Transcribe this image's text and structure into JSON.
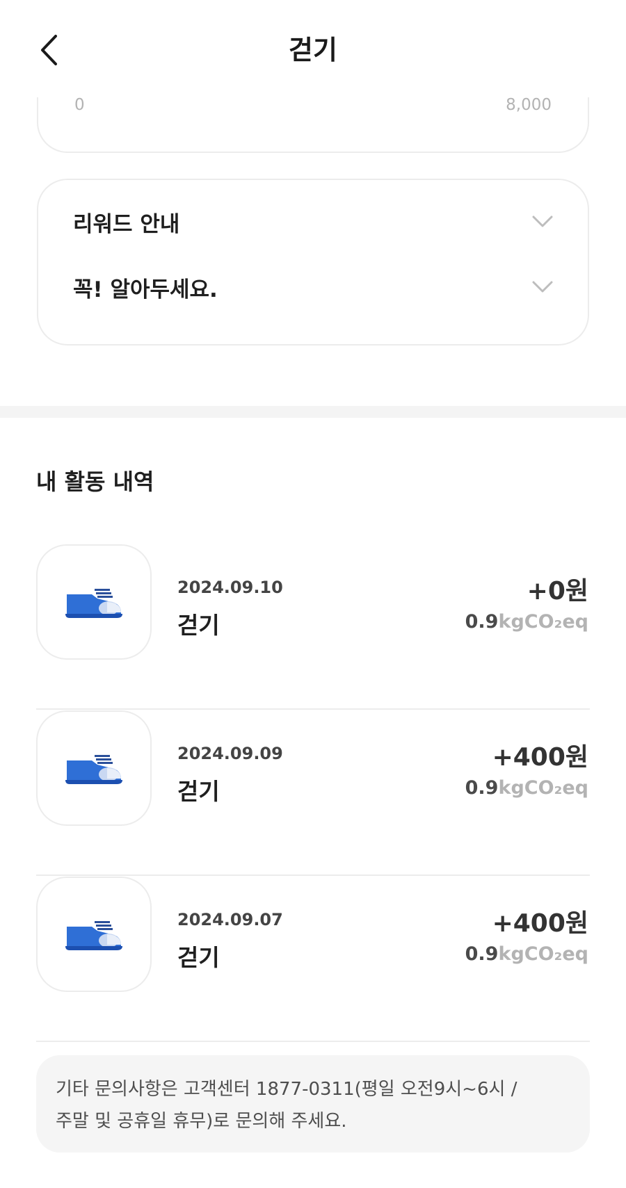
{
  "header": {
    "title": "걷기",
    "back_icon": "chevron-left-icon"
  },
  "range": {
    "min": "0",
    "max": "8,000"
  },
  "info": [
    {
      "label": "리워드 안내",
      "icon": "chevron-down-icon"
    },
    {
      "label": "꼭! 알아두세요.",
      "icon": "chevron-down-icon"
    }
  ],
  "section": {
    "title": "내 활동 내역"
  },
  "activities": [
    {
      "date": "2024.09.10",
      "name": "걷기",
      "amount": "+0원",
      "co2_value": "0.9",
      "co2_unit": "kgCO₂eq",
      "icon": "sneaker-icon"
    },
    {
      "date": "2024.09.09",
      "name": "걷기",
      "amount": "+400원",
      "co2_value": "0.9",
      "co2_unit": "kgCO₂eq",
      "icon": "sneaker-icon"
    },
    {
      "date": "2024.09.07",
      "name": "걷기",
      "amount": "+400원",
      "co2_value": "0.9",
      "co2_unit": "kgCO₂eq",
      "icon": "sneaker-icon"
    }
  ],
  "notice": {
    "line1": "기타 문의사항은 고객센터 1877-0311(평일 오전9시~6시 /",
    "line2": "주말 및 공휴일 휴무)로 문의해 주세요."
  },
  "colors": {
    "accent_blue": "#2f6fd6",
    "border": "#ececec",
    "muted": "#b3b3b3"
  }
}
